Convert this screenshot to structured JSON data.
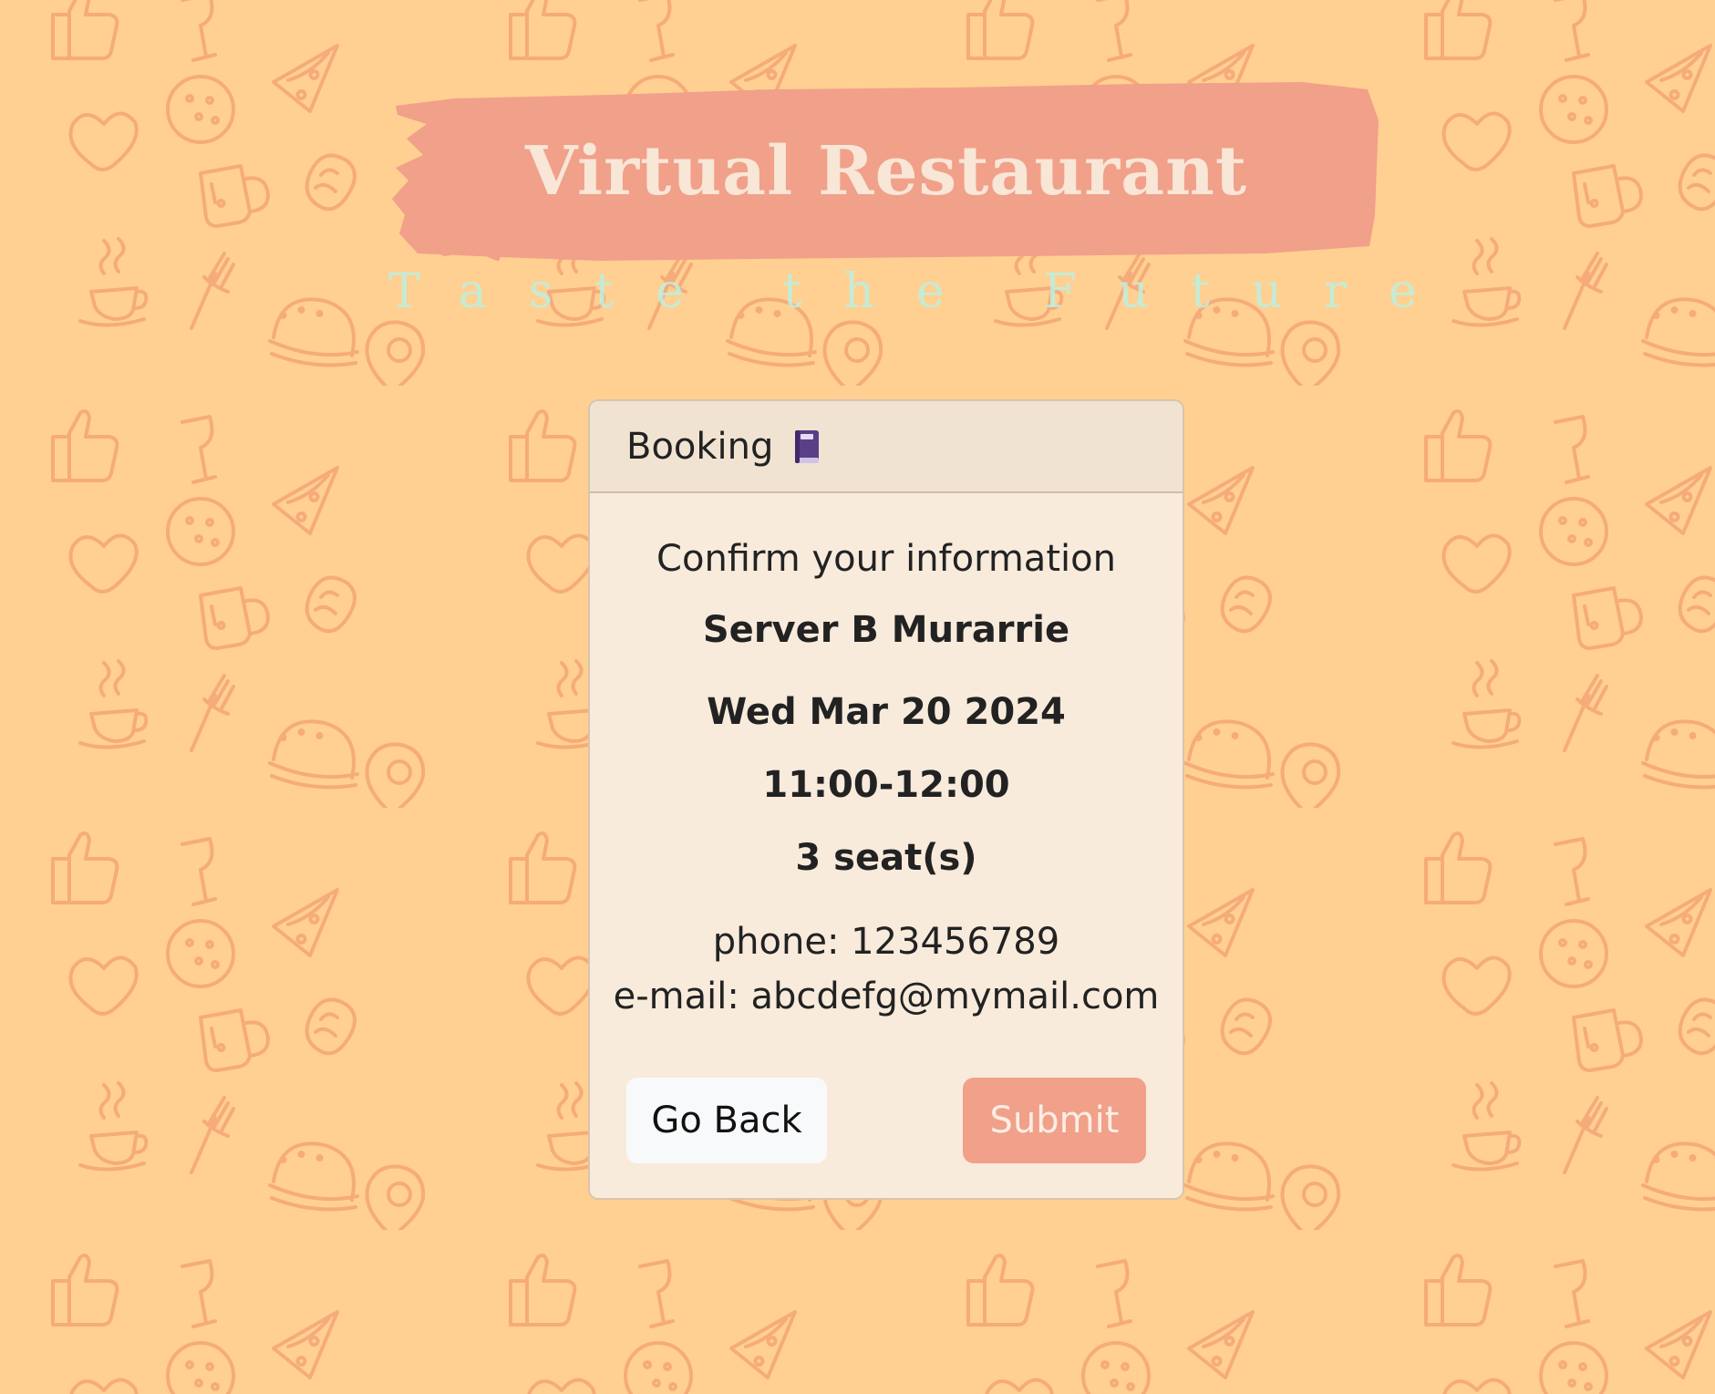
{
  "colors": {
    "background": "#ffd091",
    "pattern_stroke": "#f5a878",
    "brush": "#f1a08a",
    "title_text": "#f8e6d6",
    "tagline_text": "#bdf0e2",
    "card_background": "#f8ebdc",
    "card_header_background": "#f1e3d2",
    "submit_button": "#f1a08a",
    "back_button": "#f8f9fb"
  },
  "background_icons": [
    "thumbs-up-icon",
    "wine-glass-icon",
    "pizza-slice-icon",
    "cookie-icon",
    "heart-icon",
    "beer-mug-icon",
    "hot-dog-icon",
    "coffee-cup-icon",
    "fork-icon",
    "burger-icon",
    "map-pin-icon",
    "bell-icon",
    "bread-icon",
    "steak-icon"
  ],
  "header": {
    "title": "Virtual Restaurant",
    "tagline": "Taste the Future"
  },
  "booking": {
    "header_title": "Booking",
    "header_icon": "book-icon",
    "confirm_text": "Confirm your information",
    "restaurant": "Server B Murarrie",
    "date": "Wed Mar 20 2024",
    "time": "11:00-12:00",
    "seats": "3 seat(s)",
    "phone": "phone: 123456789",
    "email": "e-mail: abcdefg@mymail.com",
    "back_label": "Go Back",
    "submit_label": "Submit"
  }
}
